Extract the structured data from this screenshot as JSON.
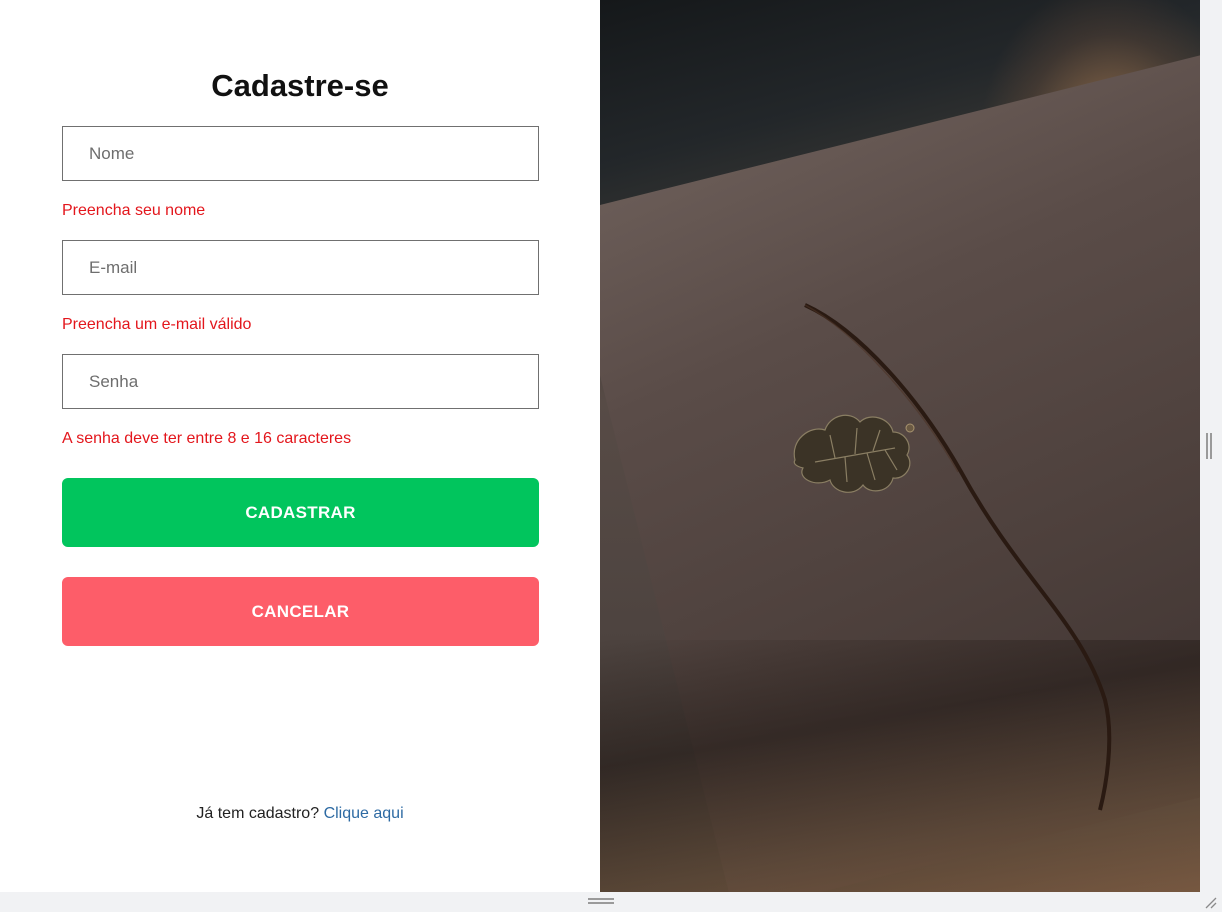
{
  "signup": {
    "title": "Cadastre-se",
    "fields": {
      "name_placeholder": "Nome",
      "email_placeholder": "E-mail",
      "password_placeholder": "Senha"
    },
    "errors": {
      "name": "Preencha seu nome",
      "email": "Preencha um e-mail válido",
      "password": "A senha deve ter entre 8 e 16 caracteres"
    },
    "buttons": {
      "submit": "CADASTRAR",
      "cancel": "CANCELAR"
    },
    "footer": {
      "prompt": "Já tem cadastro?",
      "link": "Clique aqui"
    }
  },
  "colors": {
    "submit": "#01c55d",
    "cancel": "#fd5d69",
    "error": "#e3161c",
    "link": "#2d6aa3"
  }
}
